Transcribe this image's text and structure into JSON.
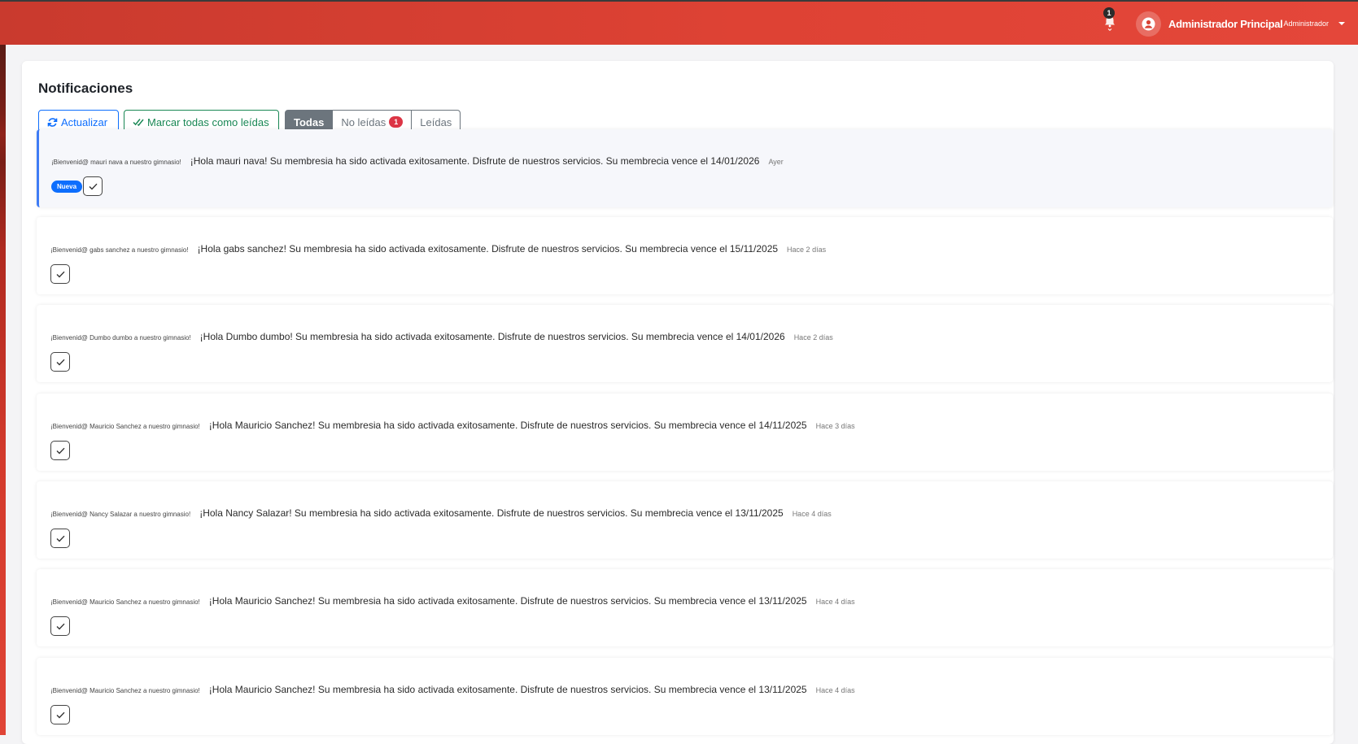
{
  "header": {
    "bell_count": "1",
    "user_name": "Administrador Principal",
    "user_role": "Administrador"
  },
  "page": {
    "title": "Notificaciones"
  },
  "toolbar": {
    "refresh_label": "Actualizar",
    "mark_all_label": "Marcar todas como leídas"
  },
  "tabs": {
    "all": "Todas",
    "unread": "No leídas",
    "unread_count": "1",
    "read": "Leídas",
    "active": "Todas"
  },
  "badges": {
    "new": "Nueva"
  },
  "notifications": [
    {
      "title": "¡Bienvenid@ mauri nava a nuestro gimnasio!",
      "message": "¡Hola mauri nava! Su membresia ha sido activada exitosamente. Disfrute de nuestros servicios. Su membrecia vence el 14/01/2026",
      "time": "Ayer",
      "unread": true
    },
    {
      "title": "¡Bienvenid@ gabs sanchez a nuestro gimnasio!",
      "message": "¡Hola gabs sanchez! Su membresia ha sido activada exitosamente. Disfrute de nuestros servicios. Su membrecia vence el 15/11/2025",
      "time": "Hace 2 días",
      "unread": false
    },
    {
      "title": "¡Bienvenid@ Dumbo dumbo a nuestro gimnasio!",
      "message": "¡Hola Dumbo dumbo! Su membresia ha sido activada exitosamente. Disfrute de nuestros servicios. Su membrecia vence el 14/01/2026",
      "time": "Hace 2 días",
      "unread": false
    },
    {
      "title": "¡Bienvenid@ Mauricio Sanchez a nuestro gimnasio!",
      "message": "¡Hola Mauricio Sanchez! Su membresia ha sido activada exitosamente. Disfrute de nuestros servicios. Su membrecia vence el 14/11/2025",
      "time": "Hace 3 días",
      "unread": false
    },
    {
      "title": "¡Bienvenid@ Nancy Salazar a nuestro gimnasio!",
      "message": "¡Hola Nancy Salazar! Su membresia ha sido activada exitosamente. Disfrute de nuestros servicios. Su membrecia vence el 13/11/2025",
      "time": "Hace 4 días",
      "unread": false
    },
    {
      "title": "¡Bienvenid@ Mauricio Sanchez a nuestro gimnasio!",
      "message": "¡Hola Mauricio Sanchez! Su membresia ha sido activada exitosamente. Disfrute de nuestros servicios. Su membrecia vence el 13/11/2025",
      "time": "Hace 4 días",
      "unread": false
    },
    {
      "title": "¡Bienvenid@ Mauricio Sanchez a nuestro gimnasio!",
      "message": "¡Hola Mauricio Sanchez! Su membresia ha sido activada exitosamente. Disfrute de nuestros servicios. Su membrecia vence el 13/11/2025",
      "time": "Hace 4 días",
      "unread": false
    }
  ],
  "colors": {
    "header_red": "#de4234",
    "primary": "#0d6efd",
    "success": "#198754",
    "secondary": "#6c757d",
    "danger": "#dc3545"
  }
}
